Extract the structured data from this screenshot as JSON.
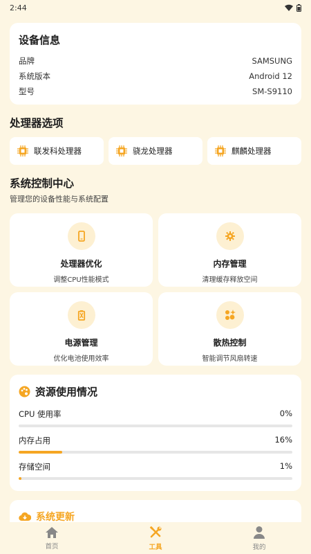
{
  "status_bar": {
    "time": "2:44"
  },
  "device_info": {
    "title": "设备信息",
    "rows": [
      {
        "label": "品牌",
        "value": "SAMSUNG"
      },
      {
        "label": "系统版本",
        "value": "Android 12"
      },
      {
        "label": "型号",
        "value": "SM-S9110"
      }
    ]
  },
  "processor": {
    "title": "处理器选项",
    "options": [
      "联发科处理器",
      "骁龙处理器",
      "麒麟处理器"
    ]
  },
  "control_center": {
    "title": "系统控制中心",
    "subtitle": "管理您的设备性能与系统配置",
    "tiles": [
      {
        "title": "处理器优化",
        "desc": "调整CPU性能模式",
        "icon": "phone-icon"
      },
      {
        "title": "内存管理",
        "desc": "清理缓存释放空间",
        "icon": "gear-icon"
      },
      {
        "title": "电源管理",
        "desc": "优化电池使用效率",
        "icon": "battery-icon"
      },
      {
        "title": "散热控制",
        "desc": "智能调节风扇转速",
        "icon": "fan-icon"
      }
    ]
  },
  "resources": {
    "title": "资源使用情况",
    "items": [
      {
        "label": "CPU 使用率",
        "value": "0%",
        "percent": 0
      },
      {
        "label": "内存占用",
        "value": "16%",
        "percent": 16
      },
      {
        "label": "存储空间",
        "value": "1%",
        "percent": 1
      }
    ]
  },
  "update": {
    "title": "系统更新"
  },
  "nav": {
    "items": [
      {
        "label": "首页",
        "icon": "home-icon"
      },
      {
        "label": "工具",
        "icon": "tools-icon"
      },
      {
        "label": "我的",
        "icon": "person-icon"
      }
    ]
  },
  "colors": {
    "accent": "#f5a623",
    "background": "#fdf6e3",
    "icon_bg": "#fdf0d2"
  }
}
